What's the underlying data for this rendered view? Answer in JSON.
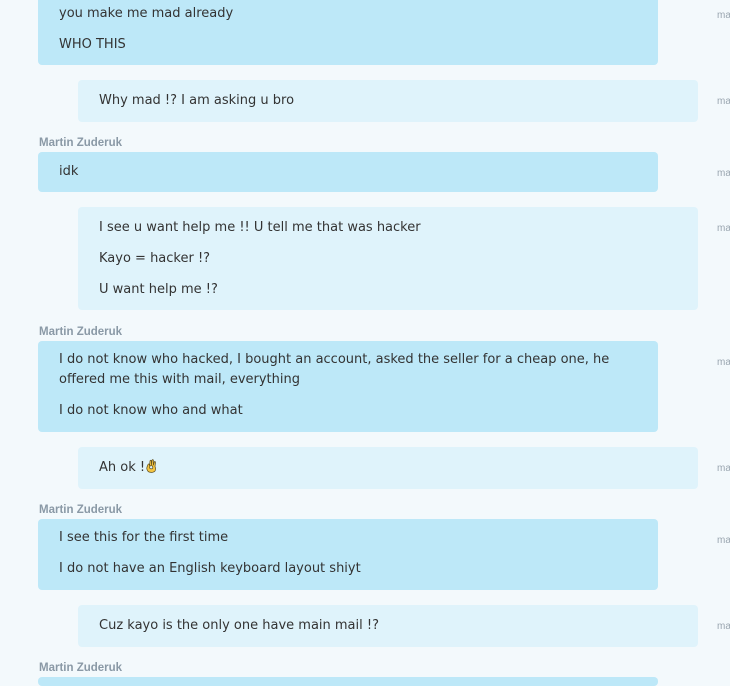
{
  "sender_name": "Martin Zuderuk",
  "time_clipped": "ma",
  "messages": [
    {
      "dir": "in",
      "lines": [
        "you make me mad already",
        "WHO THIS"
      ]
    },
    {
      "dir": "out",
      "lines": [
        "Why mad !? I am asking u bro"
      ]
    },
    {
      "dir": "in",
      "sender": "Martin Zuderuk",
      "lines": [
        "idk"
      ]
    },
    {
      "dir": "out",
      "lines": [
        "I see u want help me !! U tell me that was hacker",
        "Kayo = hacker !?",
        "U want help me !?"
      ]
    },
    {
      "dir": "in",
      "sender": "Martin Zuderuk",
      "lines": [
        "I do not know who hacked, I bought an account, asked the seller for a cheap one, he offered me this with mail, everything",
        "I do not know who and what"
      ]
    },
    {
      "dir": "out",
      "lines": [
        "Ah ok !"
      ],
      "emoji": "ok-hand-icon"
    },
    {
      "dir": "in",
      "sender": "Martin Zuderuk",
      "lines": [
        "I see this for the first time",
        "I do not have an English keyboard layout shiyt"
      ]
    },
    {
      "dir": "out",
      "lines": [
        "Cuz kayo is the only one have main mail !?"
      ]
    },
    {
      "dir": "in",
      "sender": "Martin Zuderuk",
      "lines": []
    }
  ]
}
